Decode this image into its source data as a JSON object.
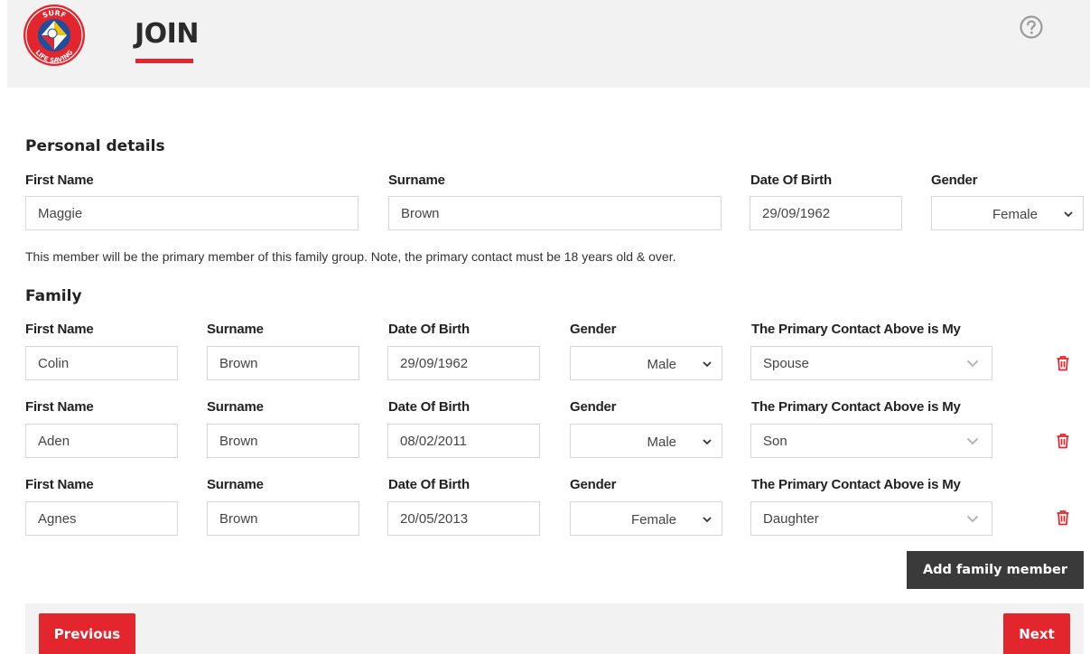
{
  "header": {
    "title": "JOIN",
    "logo_top_text": "SURF",
    "logo_bottom_text": "LIFE SAVING",
    "accent_color": "#e3262e"
  },
  "personal": {
    "section_title": "Personal details",
    "first_name_label": "First Name",
    "surname_label": "Surname",
    "dob_label": "Date Of Birth",
    "gender_label": "Gender",
    "first_name": "Maggie",
    "surname": "Brown",
    "dob": "29/09/1962",
    "gender": "Female"
  },
  "note": "This member will be the primary member of this family group. Note, the primary contact must be 18 years old & over.",
  "family": {
    "section_title": "Family",
    "labels": {
      "first_name": "First Name",
      "surname": "Surname",
      "dob": "Date Of Birth",
      "gender": "Gender",
      "relation": "The Primary Contact Above is My"
    },
    "members": [
      {
        "first_name": "Colin",
        "surname": "Brown",
        "dob": "29/09/1962",
        "gender": "Male",
        "relation": "Spouse"
      },
      {
        "first_name": "Aden",
        "surname": "Brown",
        "dob": "08/02/2011",
        "gender": "Male",
        "relation": "Son"
      },
      {
        "first_name": "Agnes",
        "surname": "Brown",
        "dob": "20/05/2013",
        "gender": "Female",
        "relation": "Daughter"
      }
    ]
  },
  "buttons": {
    "add_family_member": "Add family member",
    "previous": "Previous",
    "next": "Next"
  }
}
